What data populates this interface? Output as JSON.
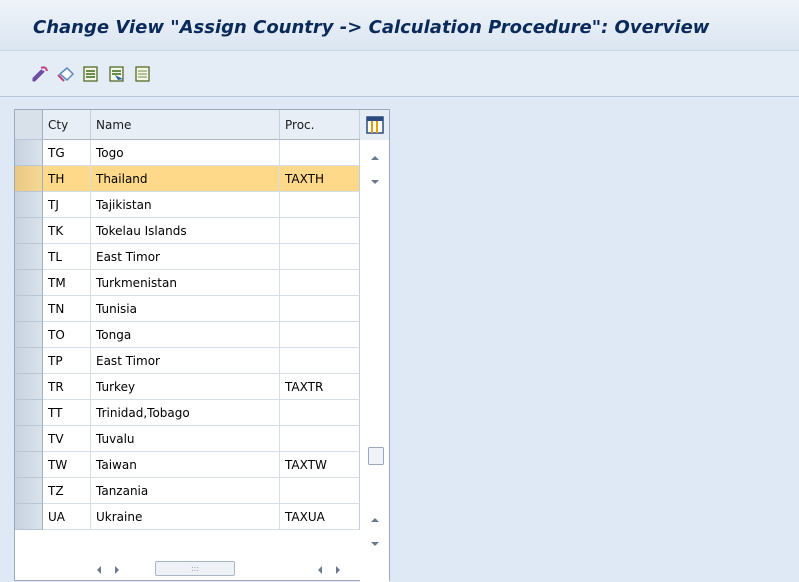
{
  "title": "Change View \"Assign Country -> Calculation Procedure\": Overview",
  "toolbar": {
    "buttons": [
      {
        "icon": "change-display-icon"
      },
      {
        "icon": "undo-icon"
      },
      {
        "icon": "select-all-icon"
      },
      {
        "icon": "select-block-icon"
      },
      {
        "icon": "deselect-all-icon"
      }
    ]
  },
  "table": {
    "headers": {
      "cty": "Cty",
      "name": "Name",
      "proc": "Proc."
    },
    "rows": [
      {
        "cty": "TG",
        "name": "Togo",
        "proc": ""
      },
      {
        "cty": "TH",
        "name": "Thailand",
        "proc": "TAXTH",
        "selected": true
      },
      {
        "cty": "TJ",
        "name": "Tajikistan",
        "proc": ""
      },
      {
        "cty": "TK",
        "name": "Tokelau Islands",
        "proc": ""
      },
      {
        "cty": "TL",
        "name": "East Timor",
        "proc": ""
      },
      {
        "cty": "TM",
        "name": "Turkmenistan",
        "proc": ""
      },
      {
        "cty": "TN",
        "name": "Tunisia",
        "proc": ""
      },
      {
        "cty": "TO",
        "name": "Tonga",
        "proc": ""
      },
      {
        "cty": "TP",
        "name": "East Timor",
        "proc": ""
      },
      {
        "cty": "TR",
        "name": "Turkey",
        "proc": "TAXTR"
      },
      {
        "cty": "TT",
        "name": "Trinidad,Tobago",
        "proc": ""
      },
      {
        "cty": "TV",
        "name": "Tuvalu",
        "proc": ""
      },
      {
        "cty": "TW",
        "name": "Taiwan",
        "proc": "TAXTW"
      },
      {
        "cty": "TZ",
        "name": "Tanzania",
        "proc": ""
      },
      {
        "cty": "UA",
        "name": "Ukraine",
        "proc": "TAXUA"
      }
    ]
  },
  "colors": {
    "highlight": "#ffd98a",
    "title": "#0a2a5a",
    "background": "#dfe9f5"
  }
}
